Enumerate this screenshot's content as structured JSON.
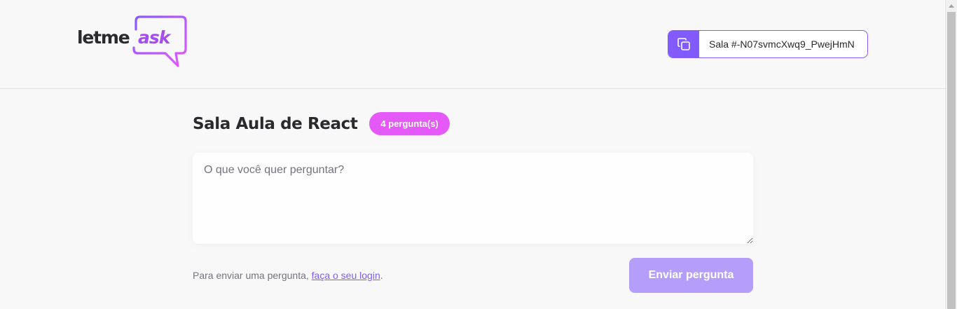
{
  "brand": {
    "logo_part1": "letme",
    "logo_part2": "ask",
    "accent_color": "#835afd",
    "badge_color": "#e559f9",
    "logo_gradient": [
      "#835afd",
      "#e559f9"
    ]
  },
  "header": {
    "room_code_label": "Sala #-N07svmcXwq9_PwejHmN",
    "copy_icon": "copy-icon"
  },
  "room": {
    "title": "Sala Aula de React",
    "question_count_badge": "4 pergunta(s)"
  },
  "form": {
    "textarea_placeholder": "O que você quer perguntar?",
    "textarea_value": "",
    "login_hint_prefix": "Para enviar uma pergunta, ",
    "login_link": "faça o seu login",
    "login_hint_suffix": ".",
    "submit_label": "Enviar pergunta"
  }
}
